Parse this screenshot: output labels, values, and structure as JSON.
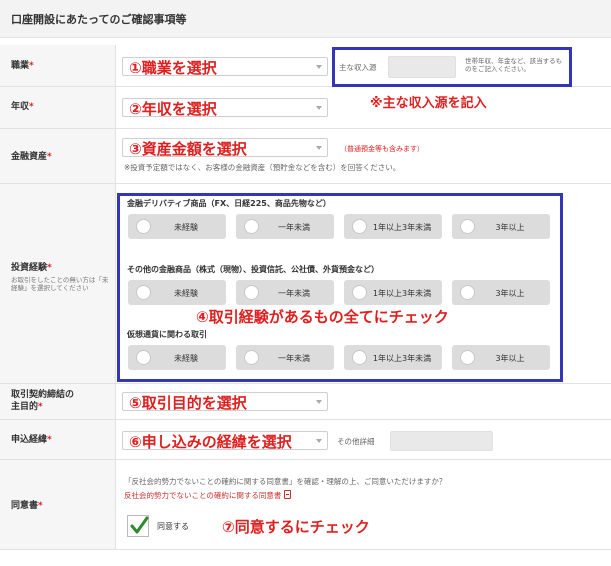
{
  "section_title": "口座開設にあたってのご確認事項等",
  "required_mark": "*",
  "occupation": {
    "label": "職業",
    "annotation": "①職業を選択",
    "income_source_label": "主な収入源",
    "income_source_hint": "世帯年収、年金など、該当するものをご記入ください。",
    "note_annotation": "※主な収入源を記入"
  },
  "income": {
    "label": "年収",
    "annotation": "②年収を選択"
  },
  "assets": {
    "label": "金融資産",
    "annotation": "③資産金額を選択",
    "side_note": "（普通預金等も含みます）",
    "note": "※投資予定額ではなく、お客様の金融資産（預貯金などを含む）を回答ください。"
  },
  "experience": {
    "label": "投資経験",
    "label_note": "お取引をしたことの無い方は「未経験」を選択してください",
    "annotation": "④取引経験があるもの全てにチェック",
    "groups": [
      {
        "title": "金融デリバティブ商品（FX、日経225、商品先物など）"
      },
      {
        "title": "その他の金融商品（株式（現物）、投資信託、公社債、外貨預金など）"
      },
      {
        "title": "仮想通貨に関わる取引"
      }
    ],
    "options": [
      "未経験",
      "一年未満",
      "1年以上3年未満",
      "3年以上"
    ]
  },
  "purpose": {
    "label_line1": "取引契約締結の",
    "label_line2": "主目的",
    "annotation": "⑤取引目的を選択"
  },
  "application": {
    "label": "申込経緯",
    "annotation": "⑥申し込みの経緯を選択",
    "other_detail_label": "その他詳細"
  },
  "consent": {
    "label": "同意書",
    "question": "「反社会的勢力でないことの確約に関する同意書」を確認・理解の上、ご同意いただけますか？",
    "link": "反社会的勢力でないことの確約に関する同意書",
    "checkbox_label": "同意する",
    "annotation": "⑦同意するにチェック"
  },
  "colors": {
    "annotation_red": "#e02020",
    "highlight_blue": "#3535b8",
    "check_green": "#2e8b2e"
  }
}
